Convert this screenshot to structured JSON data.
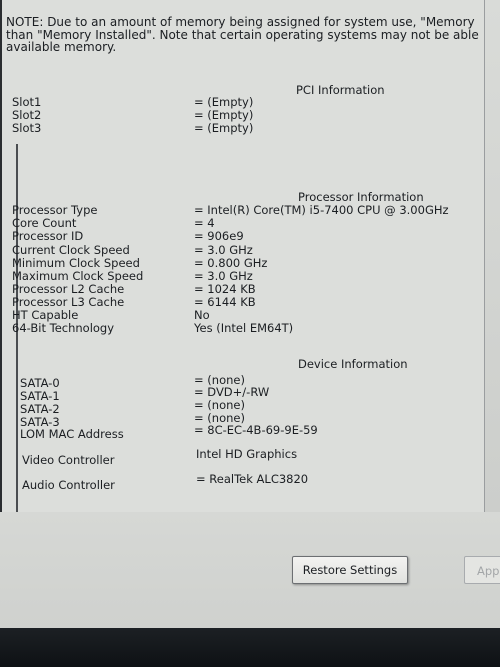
{
  "note": {
    "line1": "NOTE: Due to an amount of memory being assigned for system use, \"Memory",
    "line2": "than \"Memory Installed\". Note that certain operating systems may not be able",
    "line3": "available memory."
  },
  "pci": {
    "heading": "PCI Information",
    "rows": [
      {
        "label": "Slot1",
        "value": "= (Empty)"
      },
      {
        "label": "Slot2",
        "value": "= (Empty)"
      },
      {
        "label": "Slot3",
        "value": "= (Empty)"
      }
    ]
  },
  "processor": {
    "heading": "Processor Information",
    "rows": [
      {
        "label": "Processor Type",
        "value": "= Intel(R) Core(TM) i5-7400 CPU @ 3.00GHz"
      },
      {
        "label": "Core Count",
        "value": "= 4"
      },
      {
        "label": "Processor ID",
        "value": "= 906e9"
      },
      {
        "label": "Current Clock Speed",
        "value": "= 3.0 GHz"
      },
      {
        "label": "Minimum Clock Speed",
        "value": "= 0.800 GHz"
      },
      {
        "label": "Maximum Clock Speed",
        "value": "= 3.0 GHz"
      },
      {
        "label": "Processor L2 Cache",
        "value": "= 1024 KB"
      },
      {
        "label": "Processor L3 Cache",
        "value": "= 6144 KB"
      },
      {
        "label": "HT Capable",
        "value": "No"
      },
      {
        "label": "64-Bit Technology",
        "value": "Yes (Intel EM64T)"
      }
    ]
  },
  "device": {
    "heading": "Device Information",
    "rows": [
      {
        "label": "SATA-0",
        "value": "= (none)"
      },
      {
        "label": "SATA-1",
        "value": "= DVD+/-RW"
      },
      {
        "label": "SATA-2",
        "value": "= (none)"
      },
      {
        "label": "SATA-3",
        "value": "= (none)"
      },
      {
        "label": "LOM MAC Address",
        "value": "= 8C-EC-4B-69-9E-59"
      },
      {
        "label": "Video Controller",
        "value": "Intel HD Graphics"
      },
      {
        "label": "Audio Controller",
        "value": "= RealTek ALC3820"
      }
    ]
  },
  "buttons": {
    "restore": "Restore Settings",
    "apply": "App"
  }
}
